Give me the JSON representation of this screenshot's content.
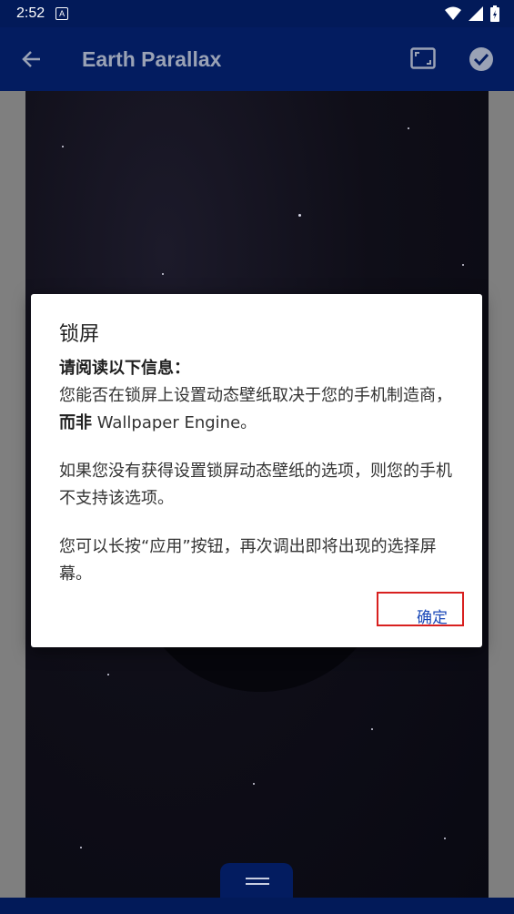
{
  "status_bar": {
    "time": "2:52",
    "notification_letter": "A"
  },
  "app_bar": {
    "title": "Earth Parallax"
  },
  "dialog": {
    "title": "锁屏",
    "heading": "请阅读以下信息：",
    "para1_prefix": "您能否在锁屏上设置动态壁纸取决于您的手机制造商，",
    "para1_bold": "而非",
    "para1_suffix": " Wallpaper Engine。",
    "para2": "如果您没有获得设置锁屏动态壁纸的选项，则您的手机不支持该选项。",
    "para3": "您可以长按“应用”按钮，再次调出即将出现的选择屏幕。",
    "ok_label": "确定"
  },
  "colors": {
    "status_bar_bg": "#021a59",
    "app_bar_bg": "#031c60",
    "dialog_button_text": "#1a48b8",
    "highlight_border": "#d8201f"
  }
}
